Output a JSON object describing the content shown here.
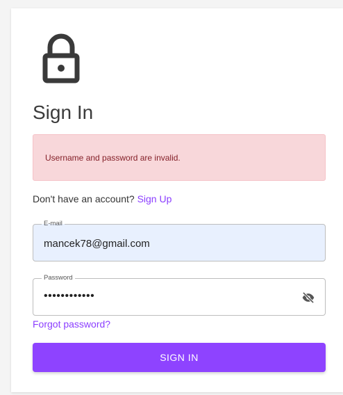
{
  "page": {
    "title": "Sign In"
  },
  "alert": {
    "message": "Username and password are invalid."
  },
  "signup": {
    "prompt": "Don't have an account?",
    "link_label": "Sign Up"
  },
  "form": {
    "email": {
      "label": "E-mail",
      "value": "mancek78@gmail.com"
    },
    "password": {
      "label": "Password",
      "masked_value": "••••••••••••",
      "toggle_icon": "eye-off-icon"
    },
    "forgot_label": "Forgot password?",
    "submit_label": "SIGN IN"
  },
  "icons": {
    "header": "lock-icon"
  },
  "colors": {
    "accent": "#8e43ff",
    "link": "#8b3dff",
    "alert_bg": "#f8d7da",
    "alert_text": "#842029",
    "autofill_bg": "#e8f0fe"
  }
}
